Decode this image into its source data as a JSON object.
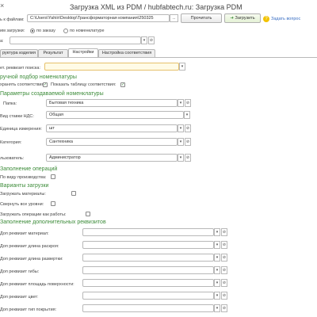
{
  "window": {
    "title": "Загрузка XML из PDM / hubfabtech.ru: Загрузка PDM",
    "close_glyph": "×"
  },
  "top": {
    "path_label": "ь к файлам:",
    "path_value": "C:\\Users\\Yahiir\\Desktop\\Трансформаторная компания\\250325",
    "ellipsis": "...",
    "read_label": "Прочитать",
    "load_label": "Загрузить",
    "load_icon": "arrow-icon",
    "ask_link": "Задать вопрос",
    "mode_label": "им загрузки:",
    "mode_options": [
      "по заказу",
      "по номенклатуре"
    ],
    "mode_selected": 0,
    "field2_label": "а:",
    "dd": "▾",
    "open": "⊘"
  },
  "tabs": [
    "руктура изделия",
    "Результат",
    "Настройки",
    "Настройка соответствия"
  ],
  "active_tab": 2,
  "search": {
    "label": "ет. реквизит поиска:"
  },
  "manual": {
    "title": "ручной подбор номенклатуры",
    "save_label": "хранять соответствия:",
    "save_checked": "✓",
    "show_label": "Показать таблицу соответствия:",
    "show_checked": "✓"
  },
  "params": {
    "title": "Параметры создаваемой номенклатуры",
    "folder_label": "Папка:",
    "folder_value": "Бытовая техника",
    "vat_label": "Вид ставки НДС:",
    "vat_value": "Общая",
    "unit_label": "Единица измерения:",
    "unit_value": "шт",
    "category_label": "Категория:",
    "category_value": "Сантехника",
    "user_label": "льзователь:",
    "user_value": "Администратор"
  },
  "ops": {
    "title": "Заполнение операций",
    "by_type_label": "По виду производства:"
  },
  "variants": {
    "title": "Варианты загрузки",
    "items": [
      "Загружать материалы:",
      "Свернуть все уровни:",
      "Загружать операции как работы:"
    ]
  },
  "extra": {
    "title": "Заполнение дополнительных реквизитов",
    "items": [
      "Доп реквизит материал:",
      "Доп реквизит длина раскроя:",
      "Доп реквизит длина развертки:",
      "Доп реквизит гибы:",
      "Доп реквизит площадь поверхности:",
      "Доп реквизит цвет:",
      "Доп реквизит тип покрытия:"
    ]
  }
}
